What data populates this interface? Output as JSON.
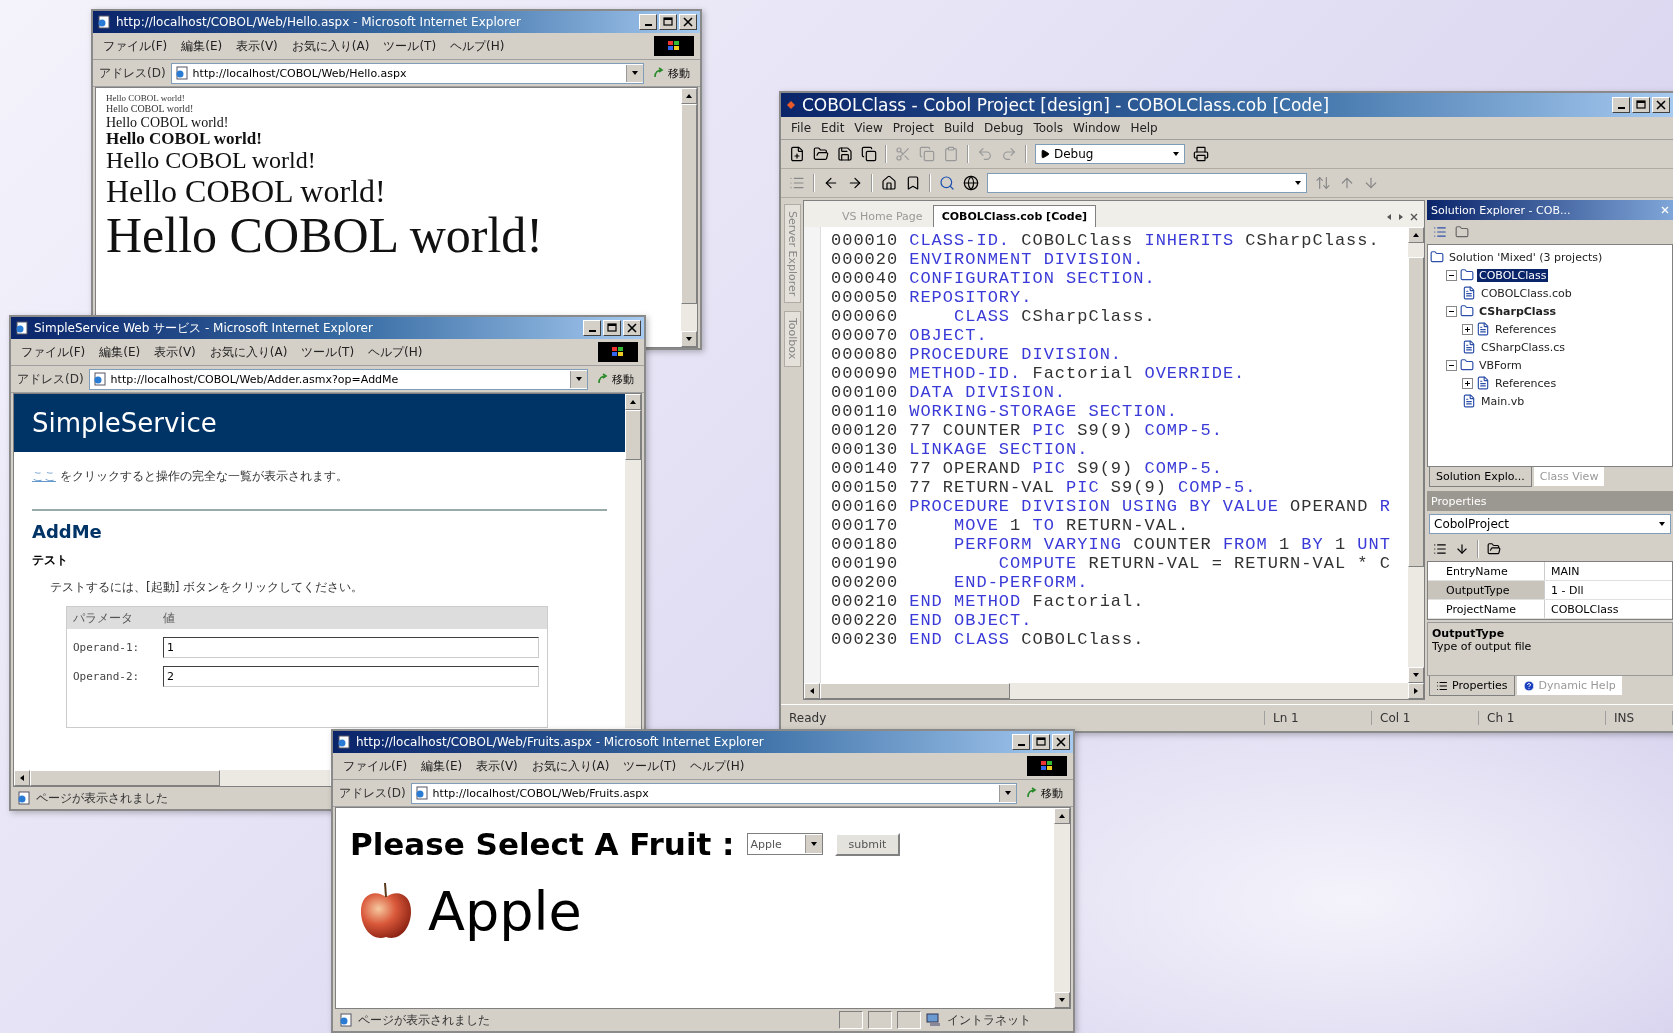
{
  "browsers": [
    {
      "title": "http://localhost/COBOL/Web/Hello.aspx - Microsoft Internet Explorer",
      "menu": [
        "ファイル(F)",
        "編集(E)",
        "表示(V)",
        "お気に入り(A)",
        "ツール(T)",
        "ヘルプ(H)"
      ],
      "address_label": "アドレス(D)",
      "url": "http://localhost/COBOL/Web/Hello.aspx",
      "go_label": "移動",
      "page": {
        "kind": "hello",
        "lines": [
          {
            "text": "Hello COBOL world!",
            "bold": false
          },
          {
            "text": "Hello COBOL world!",
            "bold": false
          },
          {
            "text": "Hello COBOL world!",
            "bold": false
          },
          {
            "text": "Hello COBOL world!",
            "bold": true
          },
          {
            "text": "Hello COBOL world!",
            "bold": false
          },
          {
            "text": "Hello COBOL world!",
            "bold": false
          },
          {
            "text": "Hello COBOL world!",
            "bold": false
          }
        ]
      }
    },
    {
      "title": "SimpleService Web サービス - Microsoft Internet Explorer",
      "menu": [
        "ファイル(F)",
        "編集(E)",
        "表示(V)",
        "お気に入り(A)",
        "ツール(T)",
        "ヘルプ(H)"
      ],
      "address_label": "アドレス(D)",
      "url": "http://localhost/COBOL/Web/Adder.asmx?op=AddMe",
      "go_label": "移動",
      "page": {
        "kind": "service",
        "header": "SimpleService",
        "link": "ここ",
        "sentence": " をクリックすると操作の完全な一覧が表示されます。",
        "operation": "AddMe",
        "section": "テスト",
        "instruction": "テストするには、[起動] ボタンをクリックしてください。",
        "columns": [
          "パラメータ",
          "値"
        ],
        "params": [
          {
            "label": "Operand-1:",
            "value": "1"
          },
          {
            "label": "Operand-2:",
            "value": "2"
          }
        ]
      },
      "status": {
        "text": "ページが表示されました"
      }
    },
    {
      "title": "http://localhost/COBOL/Web/Fruits.aspx - Microsoft Internet Explorer",
      "menu": [
        "ファイル(F)",
        "編集(E)",
        "表示(V)",
        "お気に入り(A)",
        "ツール(T)",
        "ヘルプ(H)"
      ],
      "address_label": "アドレス(D)",
      "url": "http://localhost/COBOL/Web/Fruits.aspx",
      "go_label": "移動",
      "page": {
        "kind": "fruit",
        "heading": "Please Select A Fruit :",
        "select_value": "Apple",
        "button": "submit",
        "fruit": "Apple"
      },
      "status": {
        "text": "ページが表示されました",
        "zone": "イントラネット"
      }
    }
  ],
  "ide": {
    "title": "COBOLClass - Cobol Project [design] - COBOLClass.cob [Code]",
    "menu": [
      "File",
      "Edit",
      "View",
      "Project",
      "Build",
      "Debug",
      "Tools",
      "Window",
      "Help"
    ],
    "config": "Debug",
    "side_tabs": [
      "Server Explorer",
      "Toolbox"
    ],
    "editor_tabs": [
      {
        "label": "VS Home Page",
        "selected": false
      },
      {
        "label": "COBOLClass.cob [Code]",
        "selected": true
      }
    ],
    "code": [
      {
        "no": "000010",
        "tokens": [
          {
            "t": "CLASS-ID.",
            "kw": true
          },
          {
            "t": " COBOLClass ",
            "kw": false
          },
          {
            "t": "INHERITS",
            "kw": true
          },
          {
            "t": " CSharpClass.",
            "kw": false
          }
        ]
      },
      {
        "no": "000020",
        "tokens": [
          {
            "t": "ENVIRONMENT DIVISION.",
            "kw": true
          }
        ]
      },
      {
        "no": "000040",
        "tokens": [
          {
            "t": "CONFIGURATION SECTION.",
            "kw": true
          }
        ]
      },
      {
        "no": "000050",
        "tokens": [
          {
            "t": "REPOSITORY.",
            "kw": true
          }
        ]
      },
      {
        "no": "000060",
        "tokens": [
          {
            "t": "    CLASS",
            "kw": true
          },
          {
            "t": " CSharpClass.",
            "kw": false
          }
        ]
      },
      {
        "no": "000070",
        "tokens": [
          {
            "t": "OBJECT.",
            "kw": true
          }
        ]
      },
      {
        "no": "000080",
        "tokens": [
          {
            "t": "PROCEDURE DIVISION.",
            "kw": true
          }
        ]
      },
      {
        "no": "000090",
        "tokens": [
          {
            "t": "METHOD-ID.",
            "kw": true
          },
          {
            "t": " Factorial ",
            "kw": false
          },
          {
            "t": "OVERRIDE.",
            "kw": true
          }
        ]
      },
      {
        "no": "000100",
        "tokens": [
          {
            "t": "DATA DIVISION.",
            "kw": true
          }
        ]
      },
      {
        "no": "000110",
        "tokens": [
          {
            "t": "WORKING-STORAGE SECTION.",
            "kw": true
          }
        ]
      },
      {
        "no": "000120",
        "tokens": [
          {
            "t": "77 COUNTER ",
            "kw": false
          },
          {
            "t": "PIC",
            "kw": true
          },
          {
            "t": " S9(9) ",
            "kw": false
          },
          {
            "t": "COMP-5.",
            "kw": true
          }
        ]
      },
      {
        "no": "000130",
        "tokens": [
          {
            "t": "LINKAGE SECTION.",
            "kw": true
          }
        ]
      },
      {
        "no": "000140",
        "tokens": [
          {
            "t": "77 OPERAND ",
            "kw": false
          },
          {
            "t": "PIC",
            "kw": true
          },
          {
            "t": " S9(9) ",
            "kw": false
          },
          {
            "t": "COMP-5.",
            "kw": true
          }
        ]
      },
      {
        "no": "000150",
        "tokens": [
          {
            "t": "77 RETURN-VAL ",
            "kw": false
          },
          {
            "t": "PIC",
            "kw": true
          },
          {
            "t": " S9(9) ",
            "kw": false
          },
          {
            "t": "COMP-5.",
            "kw": true
          }
        ]
      },
      {
        "no": "000160",
        "tokens": [
          {
            "t": "PROCEDURE DIVISION USING BY VALUE",
            "kw": true
          },
          {
            "t": " OPERAND ",
            "kw": false
          },
          {
            "t": "R",
            "kw": true
          }
        ]
      },
      {
        "no": "000170",
        "tokens": [
          {
            "t": "    MOVE",
            "kw": true
          },
          {
            "t": " 1 ",
            "kw": false
          },
          {
            "t": "TO",
            "kw": true
          },
          {
            "t": " RETURN-VAL.",
            "kw": false
          }
        ]
      },
      {
        "no": "000180",
        "tokens": [
          {
            "t": "    PERFORM VARYING",
            "kw": true
          },
          {
            "t": " COUNTER ",
            "kw": false
          },
          {
            "t": "FROM",
            "kw": true
          },
          {
            "t": " 1 ",
            "kw": false
          },
          {
            "t": "BY",
            "kw": true
          },
          {
            "t": " 1 ",
            "kw": false
          },
          {
            "t": "UNT",
            "kw": true
          }
        ]
      },
      {
        "no": "000190",
        "tokens": [
          {
            "t": "        COMPUTE",
            "kw": true
          },
          {
            "t": " RETURN-VAL = RETURN-VAL * C",
            "kw": false
          }
        ]
      },
      {
        "no": "000200",
        "tokens": [
          {
            "t": "    END-PERFORM.",
            "kw": true
          }
        ]
      },
      {
        "no": "000210",
        "tokens": [
          {
            "t": "END METHOD",
            "kw": true
          },
          {
            "t": " Factorial.",
            "kw": false
          }
        ]
      },
      {
        "no": "000220",
        "tokens": [
          {
            "t": "END OBJECT.",
            "kw": true
          }
        ]
      },
      {
        "no": "000230",
        "tokens": [
          {
            "t": "END CLASS",
            "kw": true
          },
          {
            "t": " COBOLClass.",
            "kw": false
          }
        ]
      }
    ],
    "solution_explorer": {
      "title": "Solution Explorer - COB...",
      "tree": [
        {
          "label": "Solution 'Mixed' (3 projects)",
          "selected": false,
          "bold": false,
          "children": [
            {
              "label": "COBOLClass",
              "selected": true,
              "bold": false,
              "expanded": true,
              "children": [
                {
                  "label": "COBOLClass.cob",
                  "selected": false,
                  "bold": false
                }
              ]
            },
            {
              "label": "CSharpClass",
              "selected": false,
              "bold": true,
              "expanded": true,
              "children": [
                {
                  "label": "References",
                  "selected": false,
                  "bold": false,
                  "expanded": false
                },
                {
                  "label": "CSharpClass.cs",
                  "selected": false,
                  "bold": false
                }
              ]
            },
            {
              "label": "VBForm",
              "selected": false,
              "bold": false,
              "expanded": true,
              "children": [
                {
                  "label": "References",
                  "selected": false,
                  "bold": false,
                  "expanded": false
                },
                {
                  "label": "Main.vb",
                  "selected": false,
                  "bold": false
                }
              ]
            }
          ]
        }
      ],
      "tabs": [
        {
          "label": "Solution Explo...",
          "selected": true
        },
        {
          "label": "Class View",
          "selected": false
        }
      ]
    },
    "properties": {
      "title": "Properties",
      "object": "CobolProject",
      "rows": [
        {
          "name": "EntryName",
          "value": "MAIN",
          "selected": false
        },
        {
          "name": "OutputType",
          "value": "1 - Dll",
          "selected": true
        },
        {
          "name": "ProjectName",
          "value": "COBOLClass",
          "selected": false
        }
      ],
      "description_title": "OutputType",
      "description": "Type of output file",
      "tabs": [
        {
          "label": "Properties",
          "selected": true
        },
        {
          "label": "Dynamic Help",
          "selected": false
        }
      ]
    },
    "status": [
      "Ready",
      "Ln 1",
      "Col 1",
      "Ch 1",
      "INS"
    ]
  }
}
